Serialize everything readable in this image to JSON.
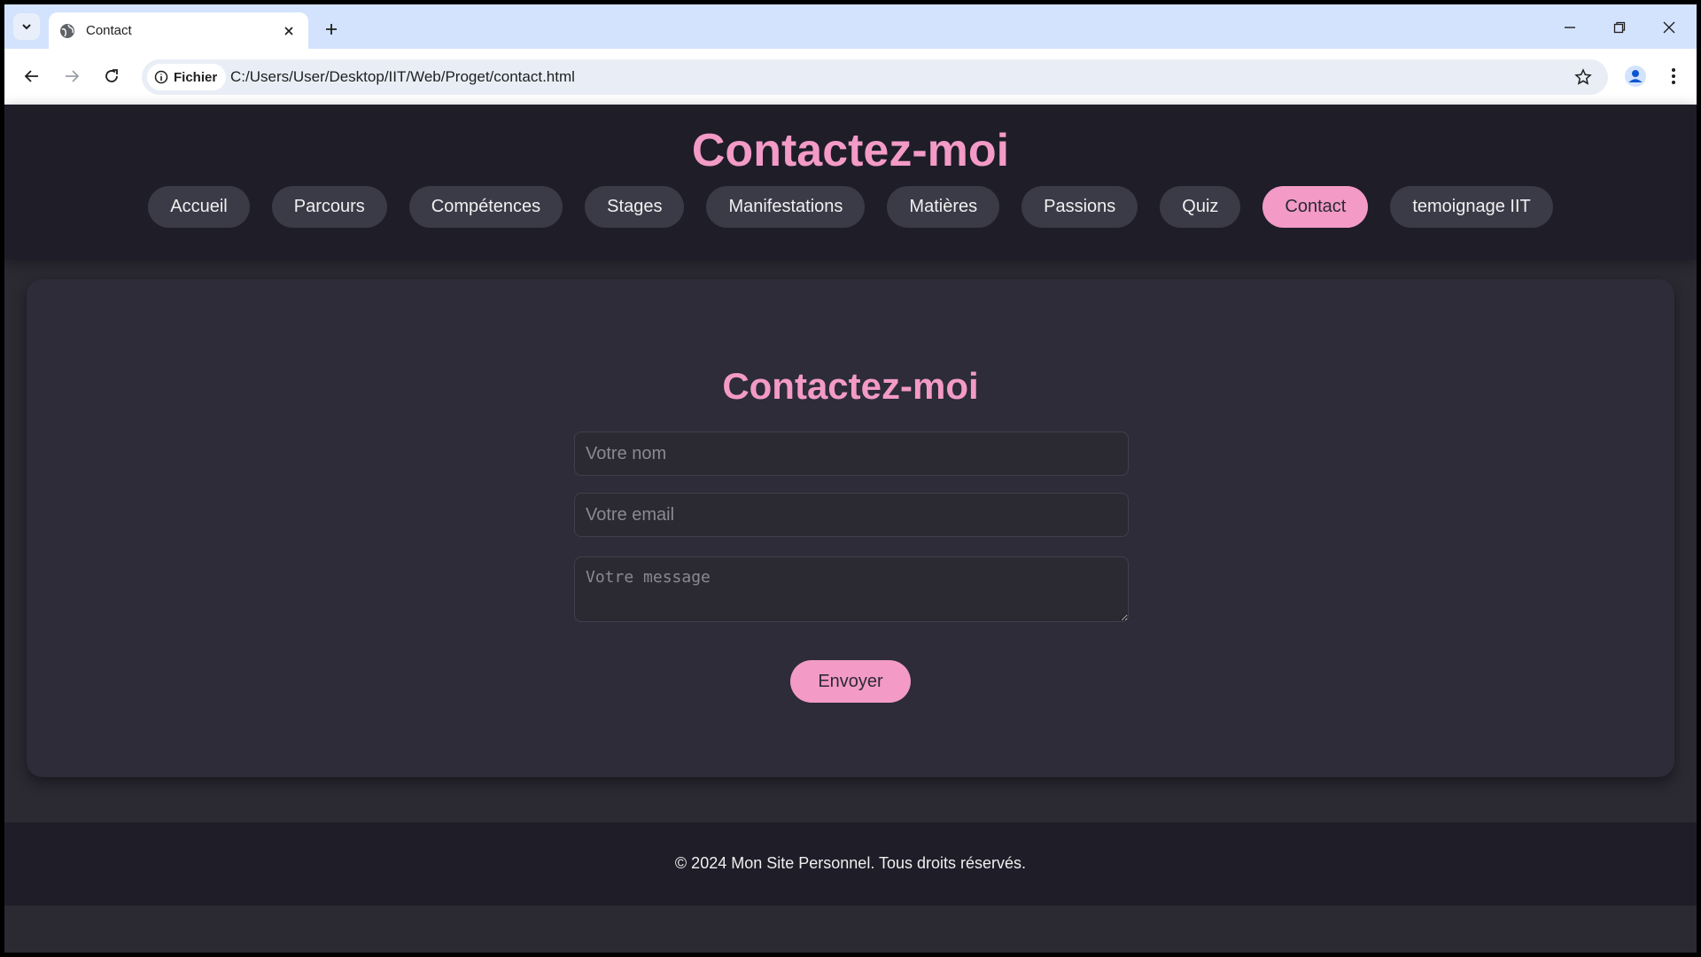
{
  "browser": {
    "tab_title": "Contact",
    "site_info_label": "Fichier",
    "url": "C:/Users/User/Desktop/IIT/Web/Proget/contact.html"
  },
  "header": {
    "title": "Contactez-moi",
    "nav": [
      {
        "label": "Accueil",
        "active": false
      },
      {
        "label": "Parcours",
        "active": false
      },
      {
        "label": "Compétences",
        "active": false
      },
      {
        "label": "Stages",
        "active": false
      },
      {
        "label": "Manifestations",
        "active": false
      },
      {
        "label": "Matières",
        "active": false
      },
      {
        "label": "Passions",
        "active": false
      },
      {
        "label": "Quiz",
        "active": false
      },
      {
        "label": "Contact",
        "active": true
      },
      {
        "label": "temoignage IIT",
        "active": false
      }
    ]
  },
  "form": {
    "title": "Contactez-moi",
    "name_placeholder": "Votre nom",
    "name_value": "",
    "email_placeholder": "Votre email",
    "email_value": "",
    "message_placeholder": "Votre message",
    "message_value": "",
    "submit_label": "Envoyer"
  },
  "footer": {
    "text": "© 2024 Mon Site Personnel. Tous droits réservés."
  },
  "colors": {
    "accent": "#f39ac7",
    "header_bg": "#1e1d28",
    "page_bg": "#2b2a33",
    "nav_item_bg": "#3b3a47"
  }
}
